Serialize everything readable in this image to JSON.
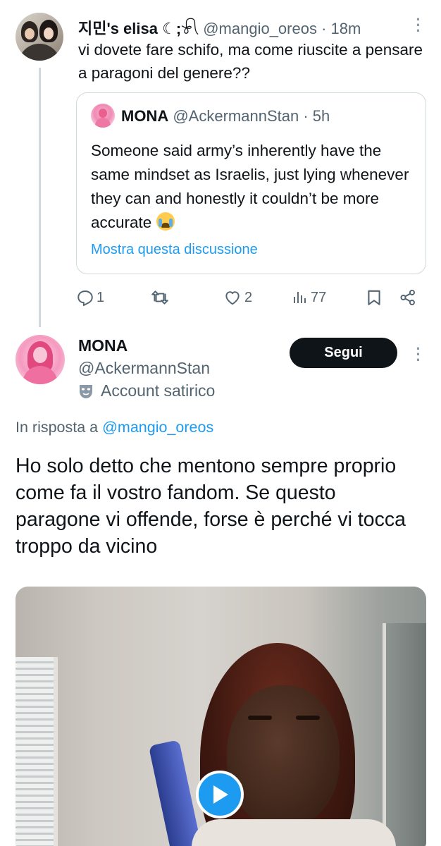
{
  "reply_tweet": {
    "display_name": "지민's elisa ☾;⁠𓍯",
    "handle": "@mangio_oreos",
    "separator": "·",
    "time": "18m",
    "text": "vi dovete fare schifo, ma come riuscite a pensare a paragoni del genere??",
    "quoted": {
      "display_name": "MONA",
      "handle": "@AckermannStan",
      "separator": "·",
      "time": "5h",
      "text": "Someone said army’s inherently have the same mindset as Israelis, just lying whenever they can and honestly it couldn’t be more accurate",
      "emoji": "loudly-crying-face",
      "link": "Mostra questa discussione"
    },
    "actions": {
      "replies": "1",
      "retweets": "",
      "likes": "2",
      "views": "77"
    }
  },
  "main_tweet": {
    "display_name": "MONA",
    "handle": "@AckermannStan",
    "label": "Account satirico",
    "follow_button": "Segui",
    "reply_prefix": "In risposta a",
    "reply_to": "@mangio_oreos",
    "text": "Ho solo detto che mentono sempre proprio come fa il vostro fandom. Se questo paragone vi offende, forse è perché vi tocca troppo da vicino"
  },
  "colors": {
    "accent": "#1d9bf0",
    "text": "#0f1419",
    "muted": "#536471",
    "border": "#cfd9de"
  }
}
